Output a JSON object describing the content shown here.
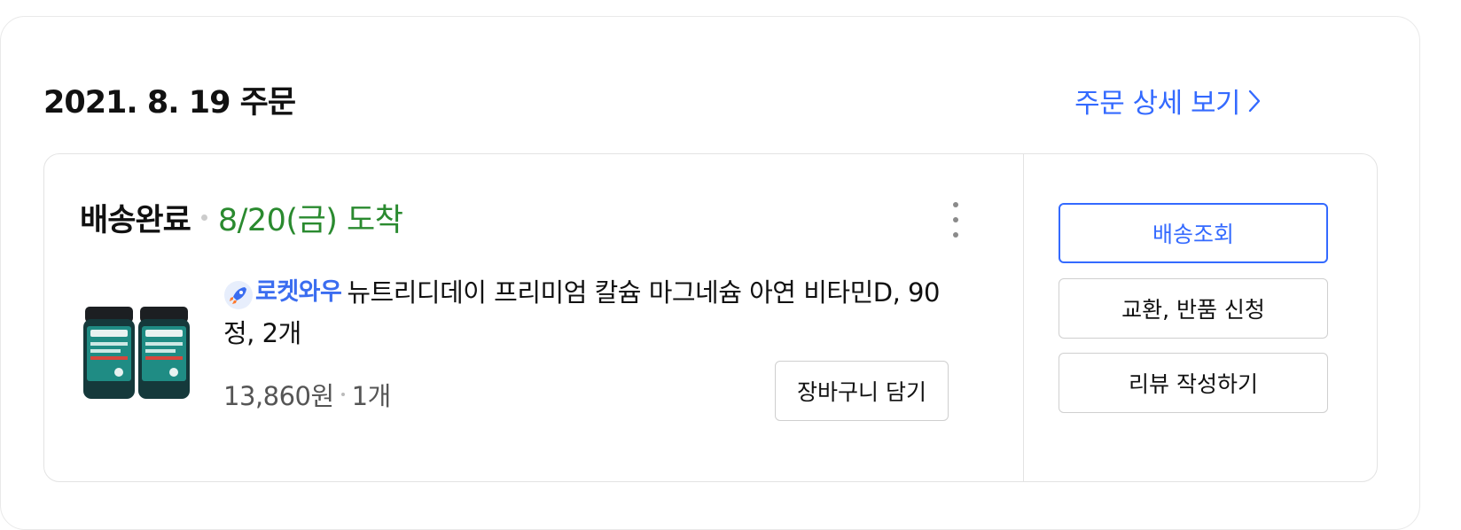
{
  "order": {
    "date_label": "2021. 8. 19 주문",
    "detail_link_label": "주문 상세 보기"
  },
  "shipment": {
    "status": "배송완료",
    "arrival": "8/20(금) 도착"
  },
  "product": {
    "badge_label": "로켓와우",
    "name": "뉴트리디데이 프리미엄 칼슘 마그네슘 아연 비타민D, 90정, 2개",
    "price": "13,860원",
    "quantity": "1개",
    "cart_button_label": "장바구니 담기",
    "image_icon": "supplement-bottles-image"
  },
  "actions": [
    {
      "label": "배송조회"
    },
    {
      "label": "교환, 반품 신청"
    },
    {
      "label": "리뷰 작성하기"
    }
  ],
  "colors": {
    "accent": "#346aff",
    "arrival": "#2a8a2f",
    "rocket_badge": "#3b6df0"
  }
}
